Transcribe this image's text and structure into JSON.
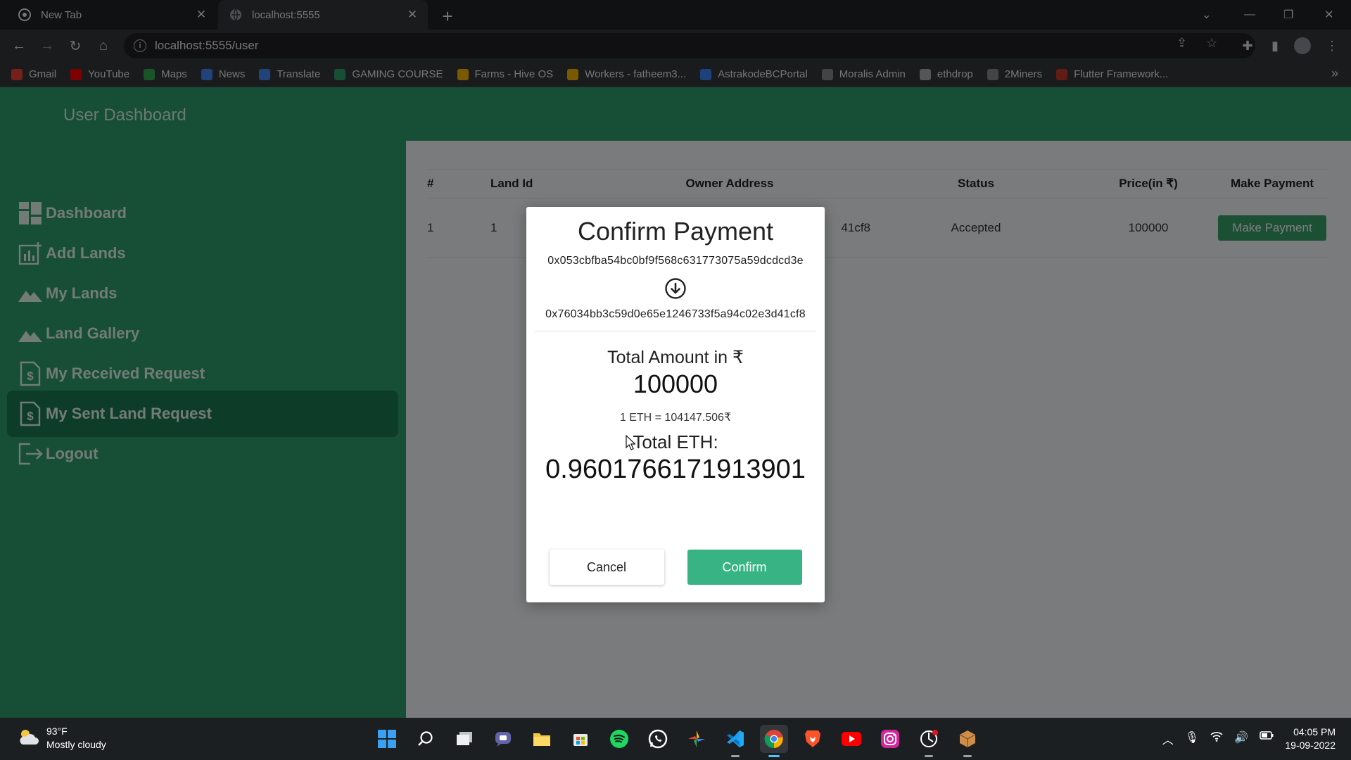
{
  "browser": {
    "tabs": [
      {
        "title": "New Tab"
      },
      {
        "title": "localhost:5555"
      }
    ],
    "url": "localhost:5555/user",
    "bookmarks": [
      {
        "label": "Gmail",
        "color": "#ea4335",
        "icon": "gmail-icon"
      },
      {
        "label": "YouTube",
        "color": "#ff0000",
        "icon": "youtube-icon"
      },
      {
        "label": "Maps",
        "color": "#34a853",
        "icon": "maps-icon"
      },
      {
        "label": "News",
        "color": "#4285f4",
        "icon": "news-icon"
      },
      {
        "label": "Translate",
        "color": "#4285f4",
        "icon": "translate-icon"
      },
      {
        "label": "GAMING COURSE",
        "color": "#2d9c6c",
        "icon": "gaming-course-icon"
      },
      {
        "label": "Farms - Hive OS",
        "color": "#f5b400",
        "icon": "hiveos-icon"
      },
      {
        "label": "Workers - fatheem3...",
        "color": "#f5b400",
        "icon": "hiveos-icon"
      },
      {
        "label": "AstrakodeBCPortal",
        "color": "#3b82f6",
        "icon": "astrakode-icon"
      },
      {
        "label": "Moralis Admin",
        "color": "#888888",
        "icon": "moralis-icon"
      },
      {
        "label": "ethdrop",
        "color": "#aaaaaa",
        "icon": "ethereum-icon"
      },
      {
        "label": "2Miners",
        "color": "#888888",
        "icon": "2miners-icon"
      },
      {
        "label": "Flutter Framework...",
        "color": "#c0392b",
        "icon": "flutter-icon"
      }
    ]
  },
  "app": {
    "brand": "User Dashboard",
    "nav": [
      {
        "label": "Dashboard",
        "icon": "dashboard-icon",
        "active": false
      },
      {
        "label": "Add Lands",
        "icon": "chart-add-icon",
        "active": false
      },
      {
        "label": "My Lands",
        "icon": "mountain-icon",
        "active": false
      },
      {
        "label": "Land Gallery",
        "icon": "mountain-icon",
        "active": false
      },
      {
        "label": "My Received Request",
        "icon": "document-dollar-icon",
        "active": false
      },
      {
        "label": "My Sent Land Request",
        "icon": "document-dollar-icon",
        "active": true
      },
      {
        "label": "Logout",
        "icon": "logout-icon",
        "active": false
      }
    ],
    "table": {
      "headers": [
        "#",
        "Land Id",
        "Owner Address",
        "Status",
        "Price(in ₹)",
        "Make Payment"
      ],
      "rows": [
        {
          "index": "1",
          "land_id": "1",
          "owner": "41cf8",
          "status": "Accepted",
          "price": "100000",
          "action": "Make Payment"
        }
      ]
    }
  },
  "modal": {
    "title": "Confirm Payment",
    "from_address": "0x053cbfba54bc0bf9f568c631773075a59dcdcd3e",
    "to_address": "0x76034bb3c59d0e65e1246733f5a94c02e3d41cf8",
    "amount_label": "Total Amount in ₹",
    "amount": "100000",
    "rate": "1 ETH = 104147.506₹",
    "eth_label": "Total ETH:",
    "eth_amount": "0.9601766171913901",
    "cancel_label": "Cancel",
    "confirm_label": "Confirm"
  },
  "taskbar": {
    "temperature": "93°F",
    "weather": "Mostly cloudy",
    "time": "04:05 PM",
    "date": "19-09-2022"
  },
  "colors": {
    "primary": "#2d9c6c",
    "active_nav": "#1b7a52",
    "confirm": "#38b383",
    "pay_button": "#38a169"
  }
}
